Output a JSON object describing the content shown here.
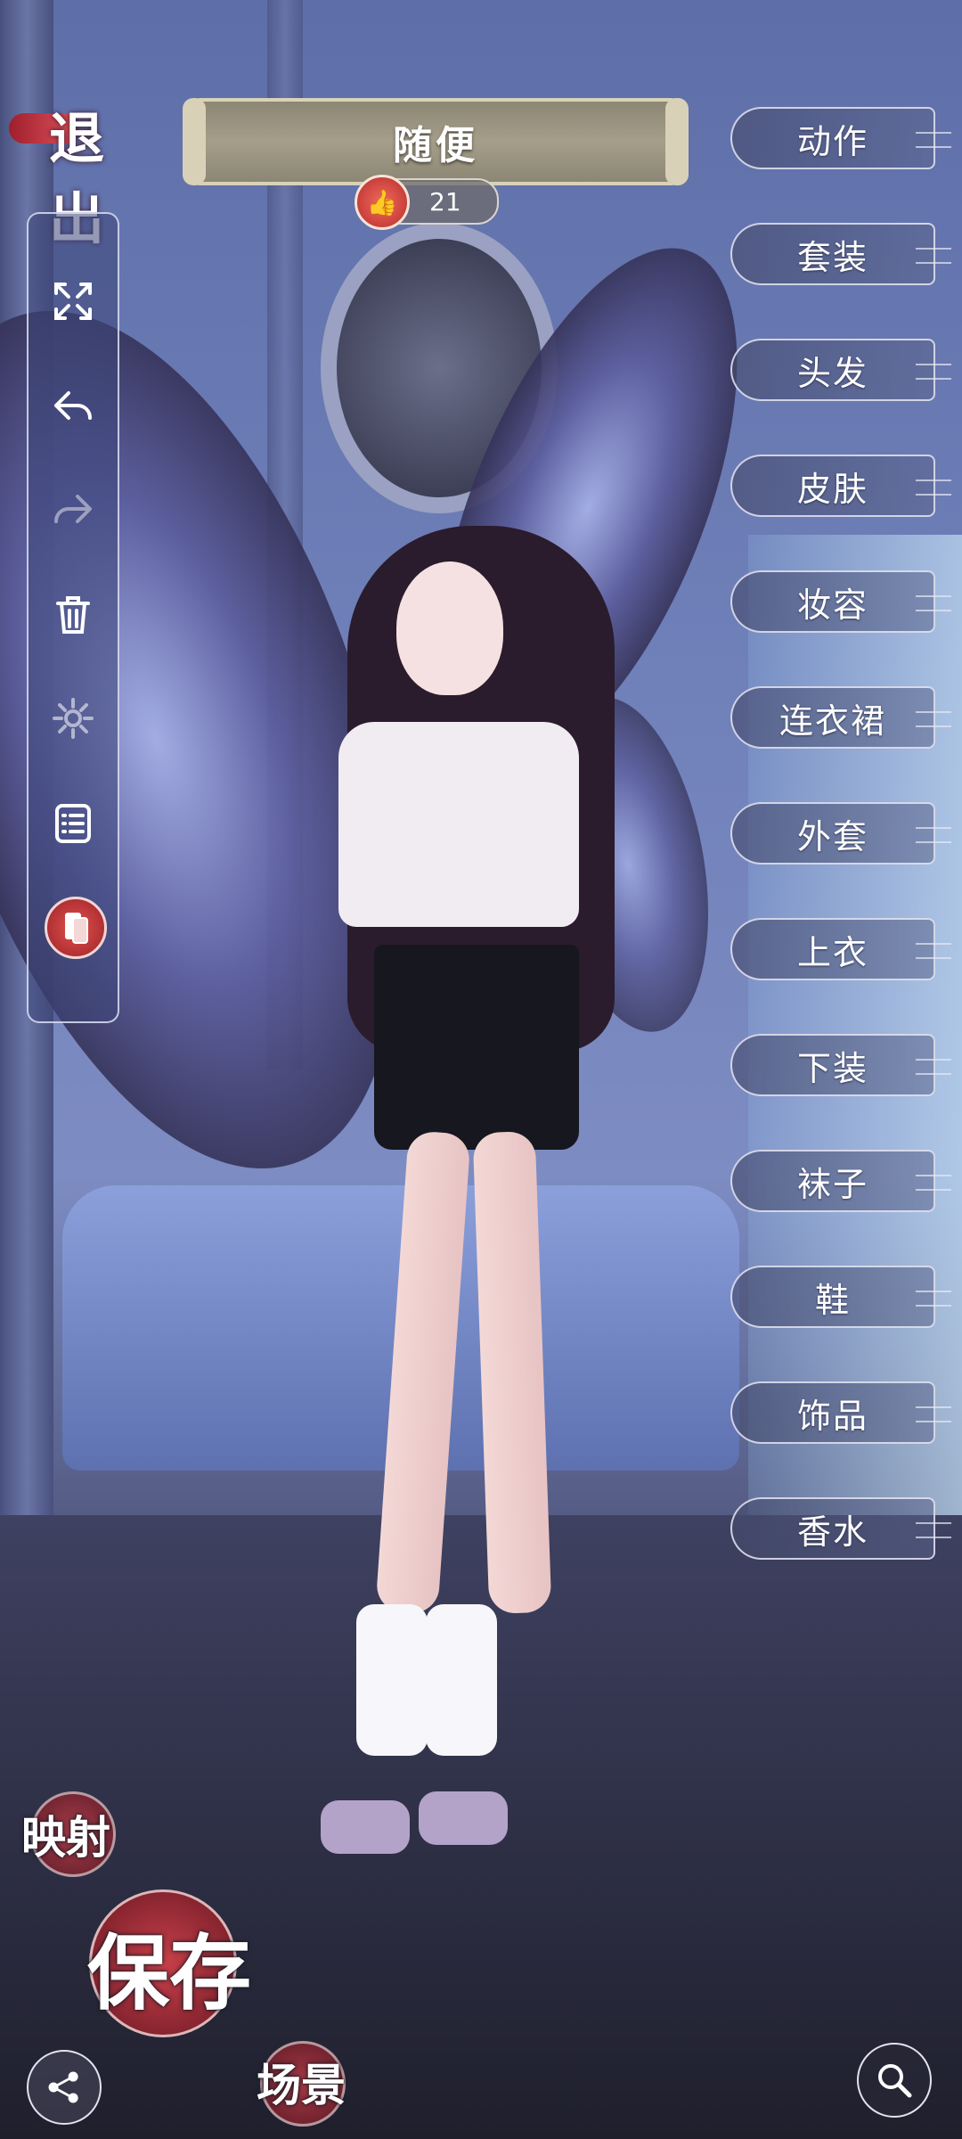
{
  "header": {
    "exit_label": "退出",
    "outfit_name": "随便",
    "likes_count": "21"
  },
  "toolbar": {
    "items": [
      {
        "icon": "fullscreen-icon"
      },
      {
        "icon": "undo-icon"
      },
      {
        "icon": "redo-icon"
      },
      {
        "icon": "trash-icon"
      },
      {
        "icon": "gear-icon"
      },
      {
        "icon": "list-icon"
      },
      {
        "icon": "phone-card-icon"
      }
    ]
  },
  "menu": {
    "items": [
      {
        "label": "动作"
      },
      {
        "label": "套装"
      },
      {
        "label": "头发"
      },
      {
        "label": "皮肤"
      },
      {
        "label": "妆容"
      },
      {
        "label": "连衣裙"
      },
      {
        "label": "外套"
      },
      {
        "label": "上衣"
      },
      {
        "label": "下装"
      },
      {
        "label": "袜子"
      },
      {
        "label": "鞋"
      },
      {
        "label": "饰品"
      },
      {
        "label": "香水"
      }
    ]
  },
  "bottom": {
    "mapping_label": "映射",
    "save_label": "保存",
    "scene_label": "场景"
  },
  "colors": {
    "accent_red": "#c9414a",
    "panel_border": "#e6e8f5"
  }
}
